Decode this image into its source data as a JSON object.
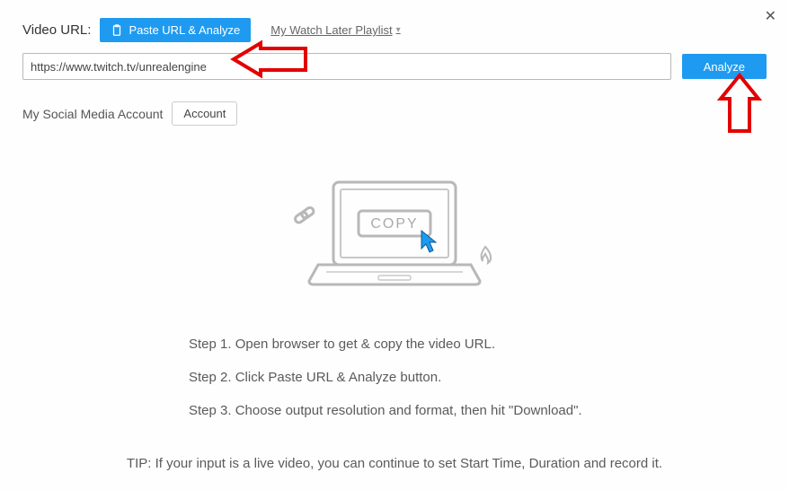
{
  "header": {
    "url_label": "Video URL:",
    "paste_button": "Paste URL & Analyze",
    "watch_later": "My Watch Later Playlist"
  },
  "input": {
    "url_value": "https://www.twitch.tv/unrealengine",
    "analyze_button": "Analyze"
  },
  "social": {
    "label": "My Social Media Account",
    "account_button": "Account"
  },
  "illustration": {
    "copy_label": "COPY"
  },
  "steps": {
    "s1": "Step 1. Open browser to get & copy the video URL.",
    "s2": "Step 2. Click Paste URL & Analyze button.",
    "s3": "Step 3. Choose output resolution and format, then hit \"Download\"."
  },
  "tip": "TIP: If your input is a live video, you can continue to set Start Time, Duration and record it."
}
